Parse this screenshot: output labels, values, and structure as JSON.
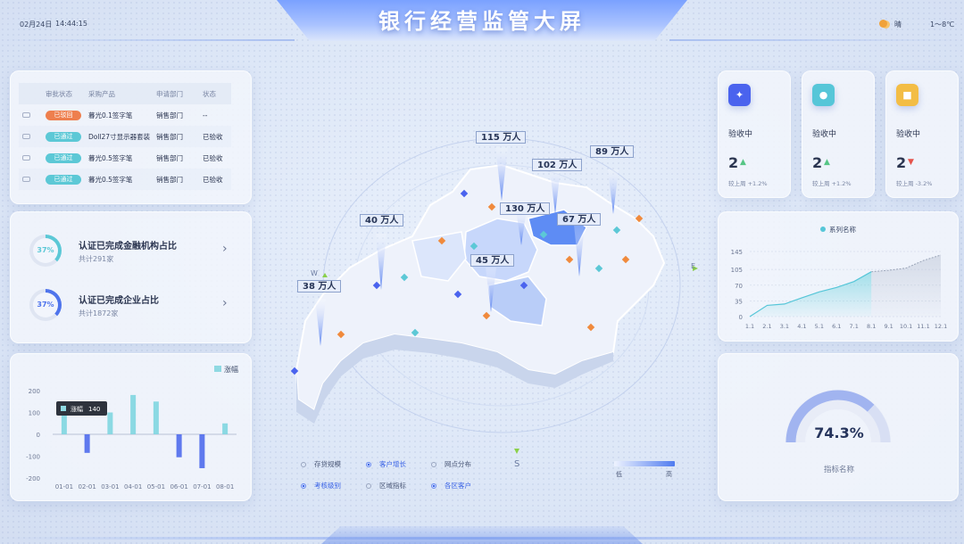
{
  "header": {
    "title": "银行经营监管大屏",
    "date": "02月24日",
    "time": "14:44:15",
    "weather": "晴",
    "temperature": "1～8℃"
  },
  "approval_table": {
    "columns": [
      "审批状态",
      "采购产品",
      "申请部门",
      "状态"
    ],
    "rows": [
      {
        "status": "已驳回",
        "status_type": "rejected",
        "product": "暮光0.1签字笔",
        "dept": "销售部门",
        "state": "--"
      },
      {
        "status": "已通过",
        "status_type": "approved",
        "product": "Doll27寸显示器套装",
        "dept": "销售部门",
        "state": "已验收"
      },
      {
        "status": "已通过",
        "status_type": "approved",
        "product": "暮光0.5签字笔",
        "dept": "销售部门",
        "state": "已验收"
      },
      {
        "status": "已通过",
        "status_type": "approved",
        "product": "暮光0.5签字笔",
        "dept": "销售部门",
        "state": "已验收"
      }
    ]
  },
  "certification": [
    {
      "percent": 37,
      "percent_label": "37%",
      "title": "认证已完成金融机构占比",
      "sub": "共计291家",
      "color": "#5cc8d6"
    },
    {
      "percent": 37,
      "percent_label": "37%",
      "title": "认证已完成企业占比",
      "sub": "共计1872家",
      "color": "#4f74ec"
    }
  ],
  "bar_chart": {
    "legend": "涨幅",
    "tooltip_label": "涨幅",
    "tooltip_value": "140",
    "chart_data": {
      "type": "bar",
      "categories": [
        "01-01",
        "02-01",
        "03-01",
        "04-01",
        "05-01",
        "06-01",
        "07-01",
        "08-01"
      ],
      "series": [
        {
          "name": "涨幅",
          "values": [
            140,
            -85,
            100,
            180,
            150,
            -105,
            -155,
            50
          ]
        }
      ],
      "ylim": [
        -200,
        200
      ],
      "yticks": [
        "200",
        "100",
        "0",
        "-100",
        "-200"
      ],
      "grid": false
    }
  },
  "kpis": [
    {
      "label": "验收中",
      "value": "2",
      "trend": "up",
      "note": "较上周 +1.2%",
      "color": "#4a63ee",
      "icon": "handshake-icon"
    },
    {
      "label": "验收中",
      "value": "2",
      "trend": "up",
      "note": "较上周 +1.2%",
      "color": "#56c6d8",
      "icon": "user-group-icon"
    },
    {
      "label": "验收中",
      "value": "2",
      "trend": "down",
      "note": "较上周 -3.2%",
      "color": "#f3bd45",
      "icon": "truck-icon"
    }
  ],
  "line_chart": {
    "chart_data": {
      "type": "area",
      "legend": [
        "系列名称"
      ],
      "x": [
        "1.1",
        "2.1",
        "3.1",
        "4.1",
        "5.1",
        "6.1",
        "7.1",
        "8.1",
        "9.1",
        "10.1",
        "11.1",
        "12.1"
      ],
      "series": [
        {
          "name": "系列名称",
          "values": [
            0,
            25,
            28,
            42,
            55,
            65,
            78,
            100,
            103,
            108,
            125,
            137
          ]
        }
      ],
      "highlight_until": "8.1",
      "ylim": [
        0,
        145
      ],
      "yticks": [
        "145",
        "105",
        "70",
        "35",
        "0"
      ]
    }
  },
  "gauge": {
    "value": 74.3,
    "value_label": "74.3%",
    "name": "指标名称"
  },
  "map": {
    "labels": [
      {
        "text": "115 万人",
        "value": 115
      },
      {
        "text": "102 万人",
        "value": 102
      },
      {
        "text": "89 万人",
        "value": 89
      },
      {
        "text": "40 万人",
        "value": 40
      },
      {
        "text": "130 万人",
        "value": 130
      },
      {
        "text": "67 万人",
        "value": 67
      },
      {
        "text": "45 万人",
        "value": 45
      },
      {
        "text": "38 万人",
        "value": 38
      }
    ],
    "compass": {
      "w": "W",
      "e": "E",
      "s": "S"
    },
    "legend_options": [
      {
        "label": "存贷规模",
        "active": false
      },
      {
        "label": "客户增长",
        "active": true
      },
      {
        "label": "网点分布",
        "active": false
      },
      {
        "label": "考核级别",
        "active": true
      },
      {
        "label": "区域指标",
        "active": false
      },
      {
        "label": "各区客户",
        "active": true
      }
    ],
    "scale": {
      "low": "低",
      "high": "高"
    }
  }
}
